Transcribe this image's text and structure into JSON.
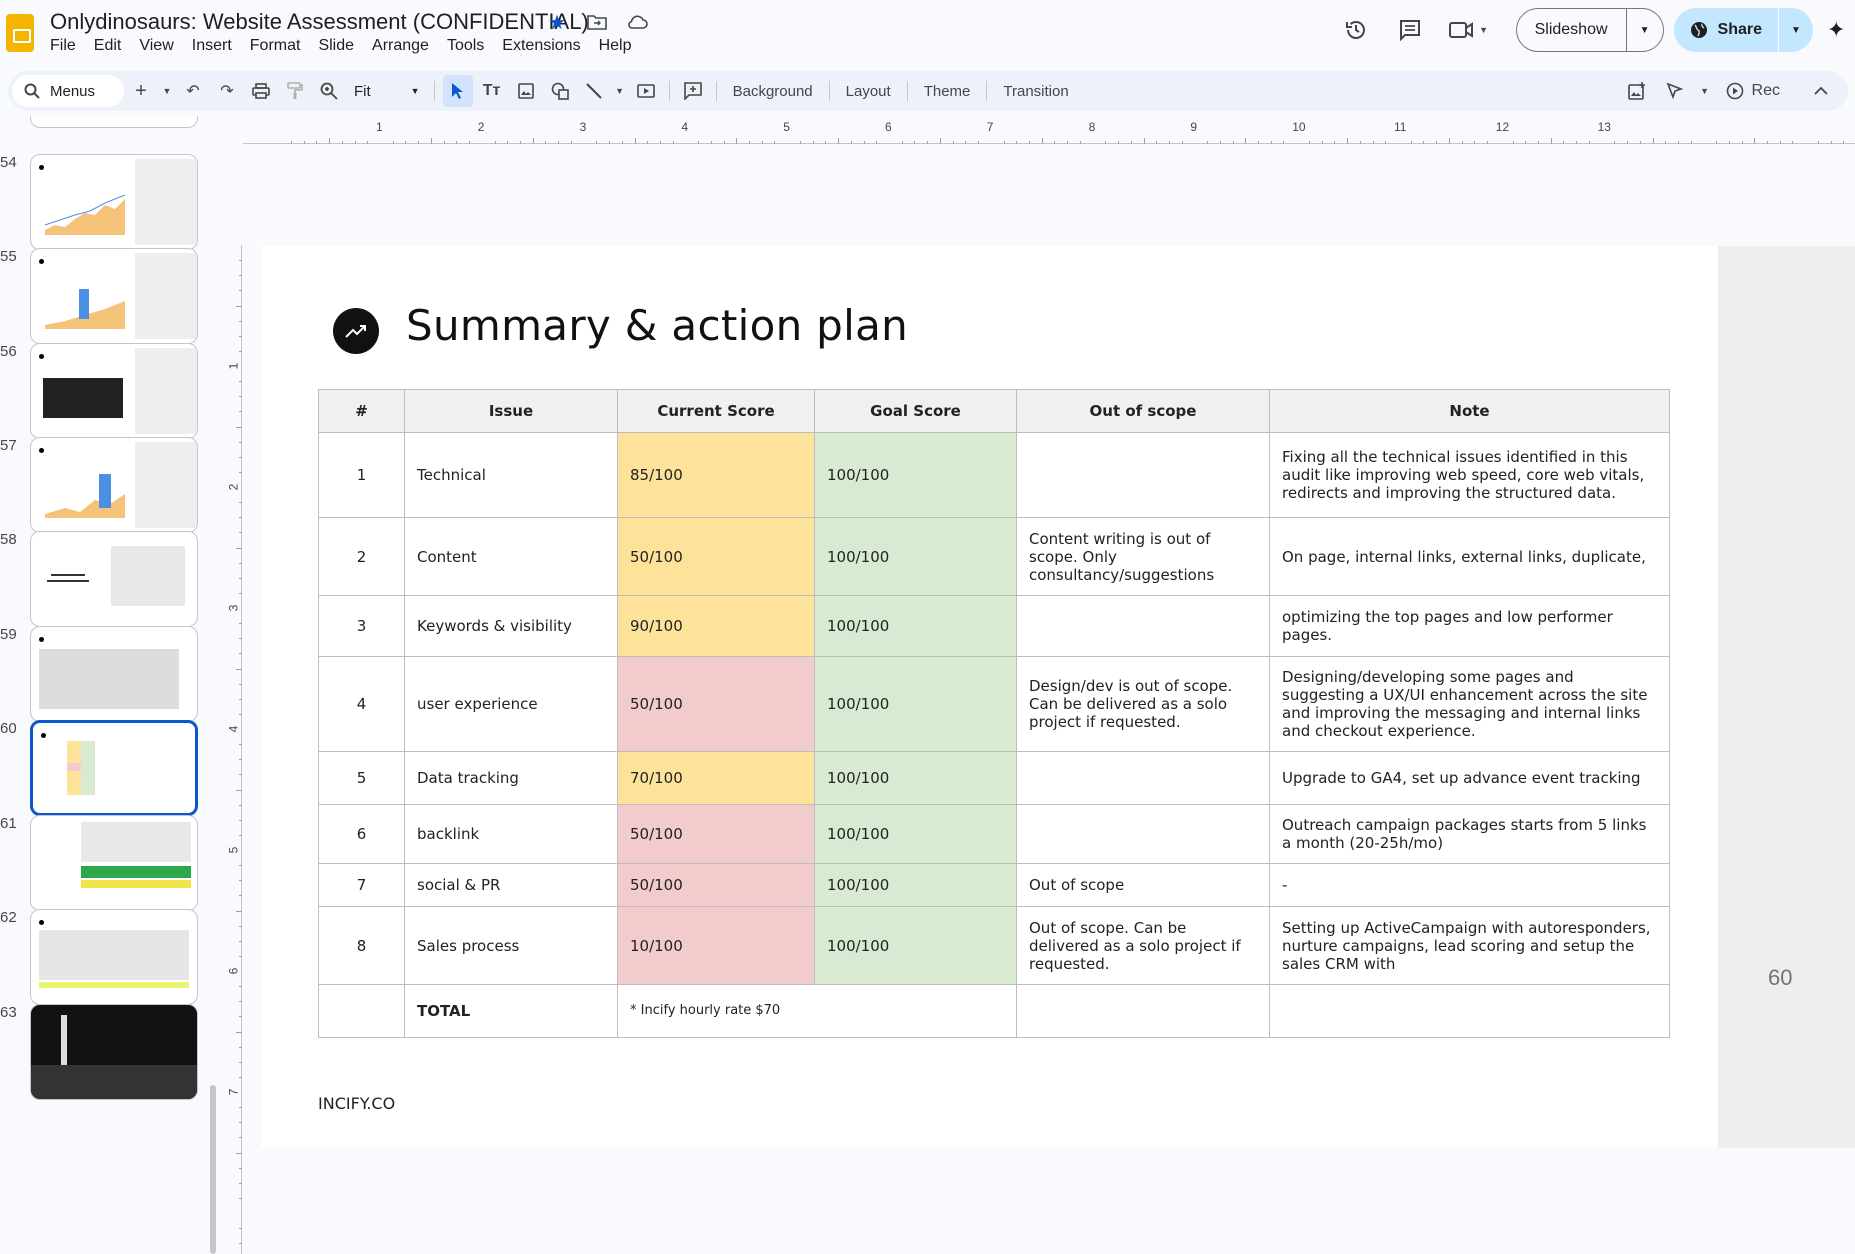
{
  "header": {
    "doc_title": "Onlydinosaurs: Website Assessment (CONFIDENTIAL)",
    "menu": [
      "File",
      "Edit",
      "View",
      "Insert",
      "Format",
      "Slide",
      "Arrange",
      "Tools",
      "Extensions",
      "Help"
    ],
    "slideshow_label": "Slideshow",
    "share_label": "Share"
  },
  "toolbar": {
    "menus_label": "Menus",
    "zoom_value": "Fit",
    "background_label": "Background",
    "layout_label": "Layout",
    "theme_label": "Theme",
    "transition_label": "Transition",
    "rec_label": "Rec"
  },
  "filmstrip": {
    "numbers": [
      "54",
      "55",
      "56",
      "57",
      "58",
      "59",
      "60",
      "61",
      "62",
      "63"
    ],
    "selected": "60"
  },
  "ruler": {
    "top": [
      "1",
      "2",
      "3",
      "4",
      "5",
      "6",
      "7",
      "8",
      "9",
      "10",
      "11",
      "12",
      "13"
    ],
    "left": [
      "1",
      "2",
      "3",
      "4",
      "5",
      "6",
      "7"
    ]
  },
  "slide": {
    "title": "Summary & action plan",
    "page_number": "60",
    "footer": "INCIFY.CO",
    "table": {
      "headers": [
        "#",
        "Issue",
        "Current Score",
        "Goal Score",
        "Out of scope",
        "Note"
      ],
      "rows": [
        {
          "n": "1",
          "issue": "Technical",
          "current": "85/100",
          "current_color": "yellow",
          "goal": "100/100",
          "scope": "",
          "note": "Fixing all the technical issues identified in this audit like improving web speed, core web vitals, redirects and improving the structured data."
        },
        {
          "n": "2",
          "issue": "Content",
          "current": "50/100",
          "current_color": "yellow",
          "goal": "100/100",
          "scope": "Content writing is out of scope. Only consultancy/suggestions",
          "note": "On page, internal links, external links, duplicate,"
        },
        {
          "n": "3",
          "issue": "Keywords & visibility",
          "current": "90/100",
          "current_color": "yellow",
          "goal": "100/100",
          "scope": "",
          "note": "optimizing the top pages and low performer pages."
        },
        {
          "n": "4",
          "issue": "user experience",
          "current": "50/100",
          "current_color": "red",
          "goal": "100/100",
          "scope": "Design/dev is out of scope. Can be delivered as a solo project if requested.",
          "note": "Designing/developing some pages and suggesting a UX/UI enhancement across the site and improving the messaging and internal links and checkout experience."
        },
        {
          "n": "5",
          "issue": "Data tracking",
          "current": "70/100",
          "current_color": "yellow",
          "goal": "100/100",
          "scope": "",
          "note": "Upgrade to GA4, set up advance event tracking"
        },
        {
          "n": "6",
          "issue": "backlink",
          "current": "50/100",
          "current_color": "red",
          "goal": "100/100",
          "scope": "",
          "note": "Outreach campaign packages starts from 5 links a month (20-25h/mo)"
        },
        {
          "n": "7",
          "issue": "social & PR",
          "current": "50/100",
          "current_color": "red",
          "goal": "100/100",
          "scope": "Out of scope",
          "note": "-"
        },
        {
          "n": "8",
          "issue": "Sales process",
          "current": "10/100",
          "current_color": "red",
          "goal": "100/100",
          "scope": "Out of scope. Can be delivered as a solo project if requested.",
          "note": "Setting up ActiveCampaign with autoresponders, nurture campaigns, lead scoring and setup the sales CRM with"
        }
      ],
      "total_label": "TOTAL",
      "total_note": "* Incify hourly rate $70"
    }
  }
}
